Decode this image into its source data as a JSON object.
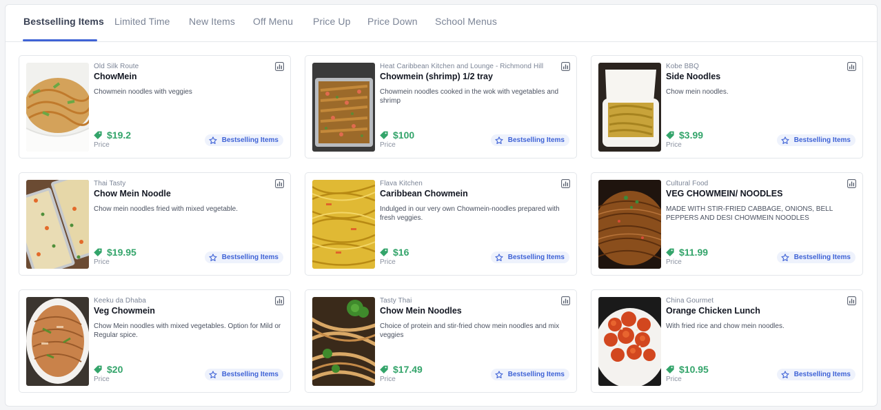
{
  "tabs": [
    {
      "label": "Bestselling Items",
      "active": true
    },
    {
      "label": "Limited Time"
    },
    {
      "label": "New Items"
    },
    {
      "label": "Off Menu"
    },
    {
      "label": "Price Up"
    },
    {
      "label": "Price Down"
    },
    {
      "label": "School Menus"
    }
  ],
  "price_label": "Price",
  "badge_label": "Bestselling Items",
  "icons": {
    "stats": "bar-chart-icon",
    "price_tag": "price-tag-icon",
    "badge": "star-icon"
  },
  "colors": {
    "accent": "#3f63d6",
    "price": "#33a46a",
    "badge_bg": "#eef2fc"
  },
  "items": [
    {
      "vendor": "Old Silk Route",
      "title": "ChowMein",
      "description": "Chowmein noodles with veggies",
      "price": "$19.2"
    },
    {
      "vendor": "Heat Caribbean Kitchen and Lounge - Richmond Hill",
      "title": "Chowmein (shrimp) 1/2 tray",
      "description": "Chowmein noodles cooked in the wok with vegetables and shrimp",
      "price": "$100"
    },
    {
      "vendor": "Kobe BBQ",
      "title": "Side Noodles",
      "description": "Chow mein noodles.",
      "price": "$3.99"
    },
    {
      "vendor": "Thai Tasty",
      "title": "Chow Mein Noodle",
      "description": "Chow mein noodles fried with mixed vegetable.",
      "price": "$19.95"
    },
    {
      "vendor": "Flava Kitchen",
      "title": "Caribbean Chowmein",
      "description": "Indulged in our very own Chowmein-noodles prepared with fresh veggies.",
      "price": "$16"
    },
    {
      "vendor": "Cultural Food",
      "title": "VEG CHOWMEIN/ NOODLES",
      "description": "MADE WITH STIR-FRIED CABBAGE, ONIONS, BELL PEPPERS AND DESI CHOWMEIN NOODLES",
      "price": "$11.99"
    },
    {
      "vendor": "Keeku da Dhaba",
      "title": "Veg Chowmein",
      "description": "Chow Mein noodles with mixed vegetables. Option for Mild or Regular spice.",
      "price": "$20"
    },
    {
      "vendor": "Tasty Thai",
      "title": "Chow Mein Noodles",
      "description": "Choice of protein and stir-fried chow mein noodles and mix veggies",
      "price": "$17.49"
    },
    {
      "vendor": "China Gourmet",
      "title": "Orange Chicken Lunch",
      "description": "With fried rice and chow mein noodles.",
      "price": "$10.95"
    }
  ]
}
